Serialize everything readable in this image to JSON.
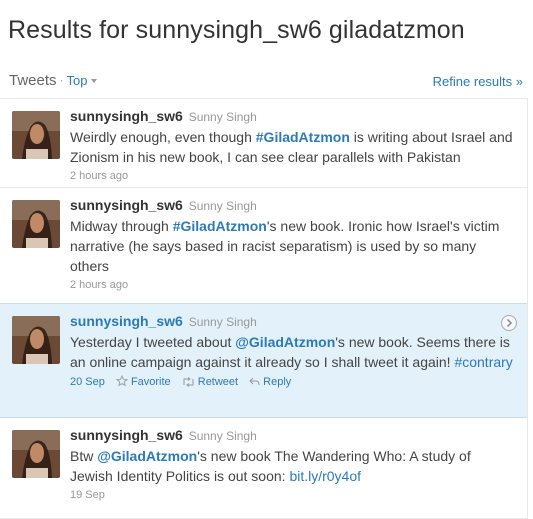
{
  "title": "Results for sunnysingh_sw6 giladatzmon",
  "filters": {
    "label": "Tweets",
    "separator": "·",
    "value": "Top",
    "refine": "Refine results »"
  },
  "tweets": [
    {
      "screen_name": "sunnysingh_sw6",
      "full_name": "Sunny Singh",
      "parts": [
        "Weirdly enough, even though ",
        "#GiladAtzmon",
        " is writing about Israel and Zionism in his new book, I can see clear parallels with Pakistan"
      ],
      "time": "2 hours ago"
    },
    {
      "screen_name": "sunnysingh_sw6",
      "full_name": "Sunny Singh",
      "parts": [
        "Midway through ",
        "#GiladAtzmon",
        "'s new book. Ironic how Israel's victim narrative (he says based in racist separatism) is used by so many others"
      ],
      "time": "2 hours ago"
    },
    {
      "screen_name": "sunnysingh_sw6",
      "full_name": "Sunny Singh",
      "parts": [
        "Yesterday I tweeted about ",
        "@GiladAtzmon",
        "'s new book. Seems there is an online campaign against it already so I shall tweet it again! ",
        "#contrary"
      ],
      "time": "20 Sep",
      "actions": {
        "favorite": "Favorite",
        "retweet": "Retweet",
        "reply": "Reply"
      }
    },
    {
      "screen_name": "sunnysingh_sw6",
      "full_name": "Sunny Singh",
      "parts": [
        "Btw ",
        "@GiladAtzmon",
        "'s new book The Wandering Who: A study of Jewish Identity Politics is out soon: ",
        "bit.ly/r0y4of"
      ],
      "time": "19 Sep"
    }
  ],
  "colors": {
    "link": "#2b7bb9",
    "highlight": "#e3f1fa",
    "muted": "#999999"
  }
}
